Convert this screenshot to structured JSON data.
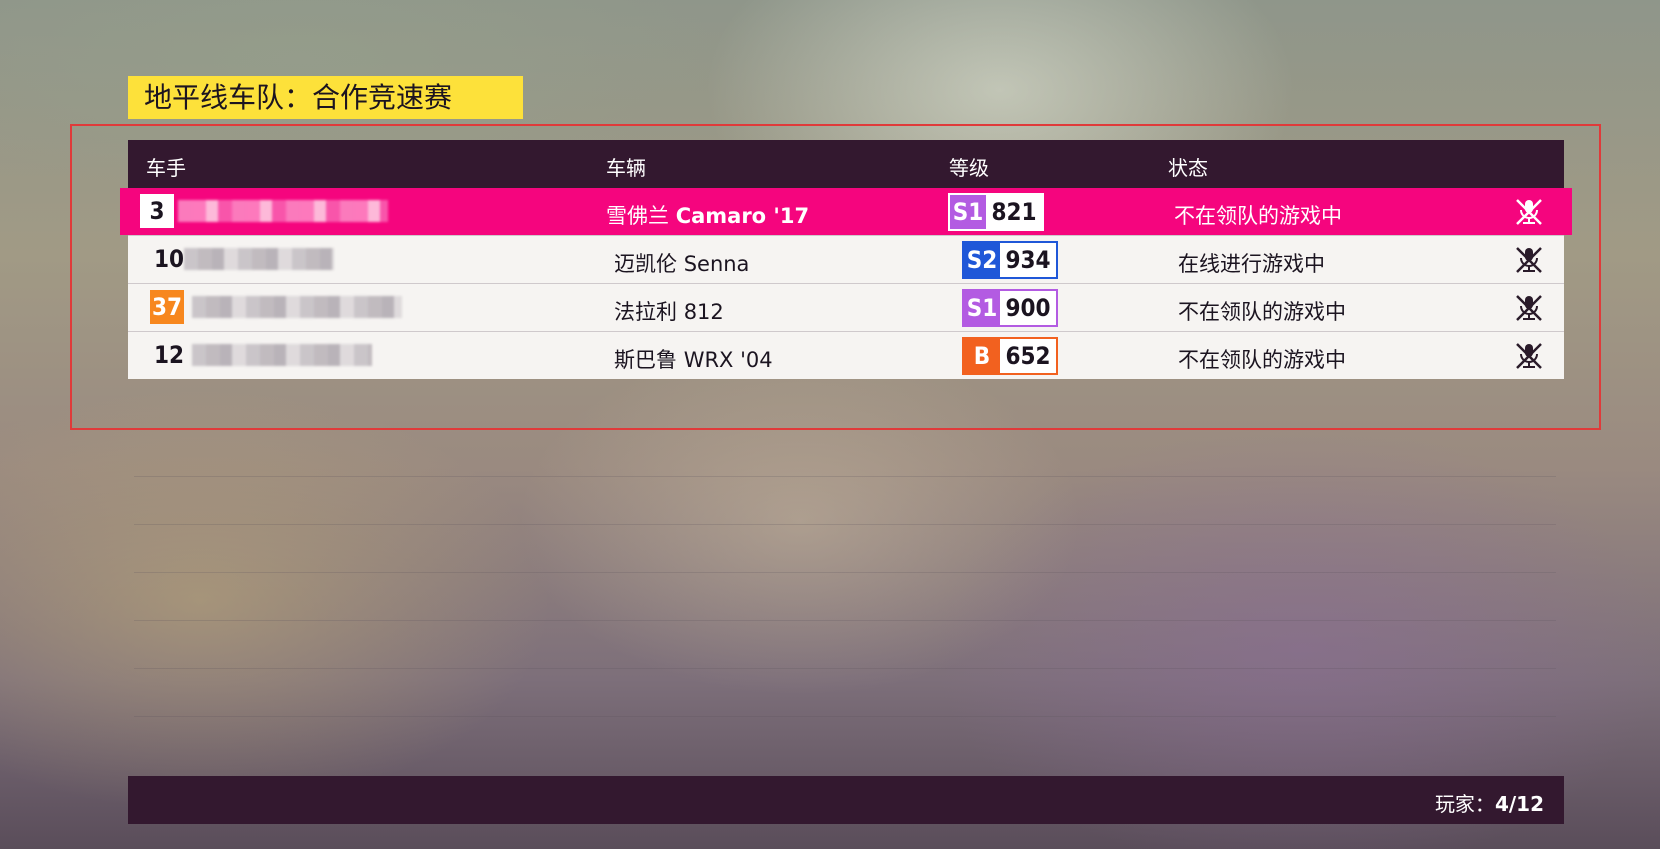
{
  "header": {
    "title": "地平线车队：合作竞速赛"
  },
  "table": {
    "columns": {
      "driver": "车手",
      "vehicle": "车辆",
      "class": "等级",
      "status": "状态"
    },
    "rows": [
      {
        "rank": "3",
        "rank_style": "boxed-white",
        "car_brand": "雪佛兰",
        "car_model": "Camaro '17",
        "pi_class": "S1",
        "pi_value": "821",
        "status": "不在领队的游戏中",
        "selected": true
      },
      {
        "rank": "10",
        "rank_style": "plain",
        "car_brand": "迈凯伦",
        "car_model": "Senna",
        "pi_class": "S2",
        "pi_value": "934",
        "status": "在线进行游戏中",
        "selected": false
      },
      {
        "rank": "37",
        "rank_style": "boxed-orange",
        "car_brand": "法拉利",
        "car_model": "812",
        "pi_class": "S1",
        "pi_value": "900",
        "status": "不在领队的游戏中",
        "selected": false
      },
      {
        "rank": "12",
        "rank_style": "plain",
        "car_brand": "斯巴鲁",
        "car_model": "WRX '04",
        "pi_class": "B",
        "pi_value": "652",
        "status": "不在领队的游戏中",
        "selected": false
      }
    ],
    "row_icon": "muted-microphone-icon"
  },
  "footer": {
    "players_label": "玩家：",
    "players_count": "4/12"
  },
  "colors": {
    "title_bg": "#fde13a",
    "header_bg": "#33182f",
    "selected_row": "#f5057e",
    "class_s1": "#b35be2",
    "class_s2": "#1f57d8",
    "class_b": "#f2611f",
    "frame": "#e03a3a"
  }
}
